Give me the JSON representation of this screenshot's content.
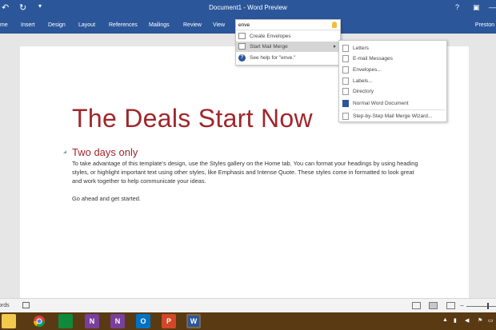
{
  "titlebar": {
    "title": "Document1 - Word Preview",
    "undo_icon": "undo-icon",
    "redo_icon": "redo-icon",
    "customize_icon": "customize-qat-icon"
  },
  "ribbon": {
    "tabs": [
      {
        "label": "me"
      },
      {
        "label": "Insert"
      },
      {
        "label": "Design"
      },
      {
        "label": "Layout"
      },
      {
        "label": "References"
      },
      {
        "label": "Mailings"
      },
      {
        "label": "Review"
      },
      {
        "label": "View"
      }
    ],
    "user": "Preston",
    "window_controls": [
      "?",
      "▣",
      "—"
    ]
  },
  "tell_me": {
    "value": "enve",
    "items": [
      {
        "label": "Create Envelopes",
        "icon": "envelope-icon"
      },
      {
        "label": "Start Mail Merge",
        "icon": "mail-merge-icon",
        "has_submenu": true,
        "highlighted": true
      },
      {
        "label": "See help for \"enve.\"",
        "icon": "help-icon"
      }
    ]
  },
  "mail_merge_submenu": {
    "items": [
      {
        "label": "Letters"
      },
      {
        "label": "E-mail Messages"
      },
      {
        "label": "Envelopes..."
      },
      {
        "label": "Labels..."
      },
      {
        "label": "Directory"
      },
      {
        "label": "Normal Word Document"
      },
      {
        "label": "Step-by-Step Mail Merge Wizard..."
      }
    ]
  },
  "document": {
    "heading": "The Deals Start Now",
    "subheading": "Two days only",
    "paragraph1": "To take advantage of this template’s design, use the Styles gallery on the Home tab. You can format your headings by using heading styles, or highlight important text using other styles, like Emphasis and Intense Quote. These styles come in formatted to look great and work together to help communicate your ideas.",
    "paragraph2": "Go ahead and get started.",
    "heading_color": "#a1262b"
  },
  "statusbar": {
    "words": "ords"
  },
  "taskbar": {
    "apps": [
      {
        "name": "file-explorer-icon",
        "label": ""
      },
      {
        "name": "chrome-icon",
        "label": ""
      },
      {
        "name": "store-icon",
        "label": ""
      },
      {
        "name": "onenote-x-icon",
        "label": "N"
      },
      {
        "name": "onenote-icon",
        "label": "N"
      },
      {
        "name": "outlook-icon",
        "label": "O"
      },
      {
        "name": "powerpoint-icon",
        "label": "P"
      },
      {
        "name": "word-icon",
        "label": "W"
      }
    ]
  },
  "colors": {
    "accent": "#2b579a",
    "heading": "#a1262b",
    "taskbar": "#5a3a12"
  }
}
